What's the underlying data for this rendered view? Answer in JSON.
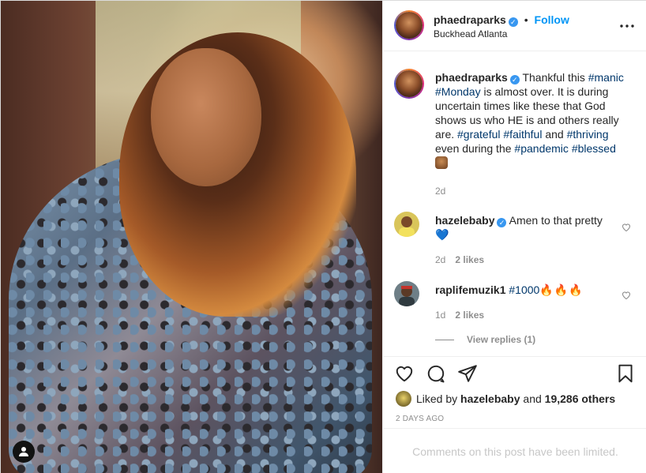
{
  "header": {
    "username": "phaedraparks",
    "separator": "•",
    "follow_label": "Follow",
    "location": "Buckhead Atlanta"
  },
  "caption": {
    "username": "phaedraparks",
    "text_1": "Thankful this",
    "tag_1": "#manic",
    "tag_2": "#Monday",
    "text_2": "is almost over. It is during uncertain times like these that God shows us who HE is and others really are.",
    "tag_3": "#grateful",
    "tag_4": "#faithful",
    "text_3": "and",
    "tag_5": "#thriving",
    "text_4": "even during the",
    "tag_6": "#pandemic",
    "tag_7": "#blessed",
    "time": "2d"
  },
  "comments": [
    {
      "username": "hazelebaby",
      "text": "Amen to that pretty",
      "emoji": "💙",
      "time": "2d",
      "likes": "2 likes"
    },
    {
      "username": "raplifemuzik1",
      "tag": "#1000",
      "emoji": "🔥🔥🔥",
      "time": "1d",
      "likes": "2 likes"
    }
  ],
  "view_replies": "View replies (1)",
  "likes": {
    "prefix": "Liked by",
    "user": "hazelebaby",
    "and": "and",
    "others": "19,286 others"
  },
  "post_age": "2 DAYS AGO",
  "comments_limited": "Comments on this post have been limited.",
  "icons": {
    "more": "more-options-icon",
    "like": "heart-icon",
    "comment": "comment-icon",
    "share": "share-icon",
    "save": "bookmark-icon",
    "user_tag": "user-tag-icon"
  },
  "colors": {
    "link": "#0095f6",
    "hashtag": "#00376b",
    "verified": "#3897f0",
    "muted": "#8e8e8e"
  }
}
